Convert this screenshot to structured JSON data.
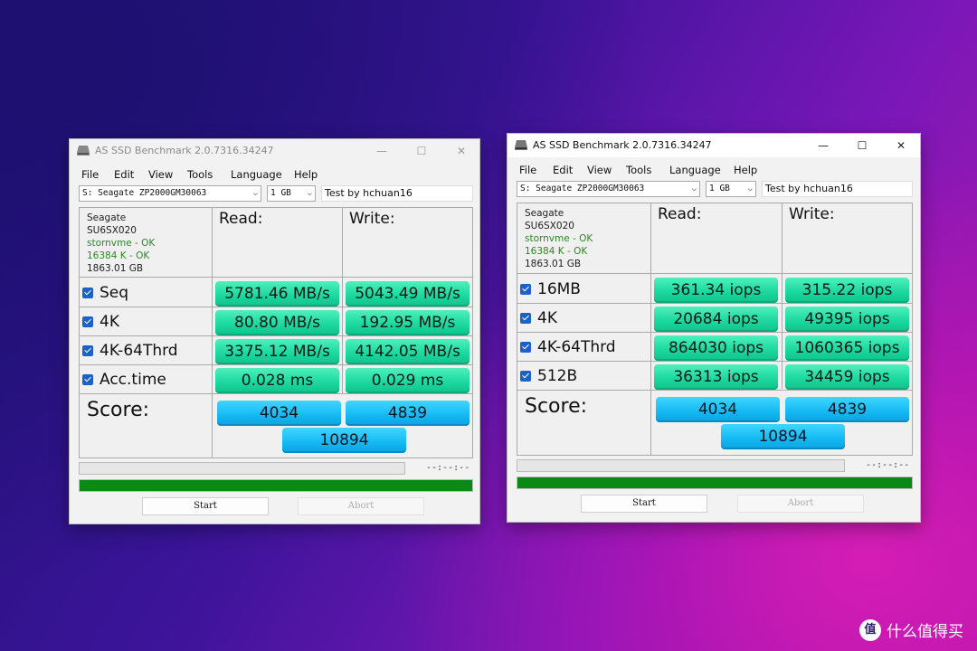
{
  "windows": [
    {
      "title": "AS SSD Benchmark 2.0.7316.34247",
      "controls": {
        "minimize": "—",
        "maximize": "☐",
        "close": "✕"
      },
      "menu": [
        "File",
        "Edit",
        "View",
        "Tools",
        "Language",
        "Help"
      ],
      "drive": "S: Seagate ZP2000GM30063",
      "size": "1 GB",
      "test_name": "Test by hchuan16",
      "info": {
        "vendor": "Seagate",
        "firmware": "SU6SX020",
        "driver": "stornvme - OK",
        "align": "16384 K - OK",
        "capacity": "1863.01 GB"
      },
      "read_label": "Read:",
      "write_label": "Write:",
      "rows": [
        {
          "label": "Seq",
          "read": "5781.46 MB/s",
          "write": "5043.49 MB/s"
        },
        {
          "label": "4K",
          "read": "80.80 MB/s",
          "write": "192.95 MB/s"
        },
        {
          "label": "4K-64Thrd",
          "read": "3375.12 MB/s",
          "write": "4142.05 MB/s"
        },
        {
          "label": "Acc.time",
          "read": "0.028 ms",
          "write": "0.029 ms"
        }
      ],
      "score_label": "Score:",
      "score_read": "4034",
      "score_write": "4839",
      "score_total": "10894",
      "elapsed": "--:--:--",
      "progress": 1.0,
      "start_label": "Start",
      "abort_label": "Abort"
    },
    {
      "title": "AS SSD Benchmark 2.0.7316.34247",
      "controls": {
        "minimize": "—",
        "maximize": "☐",
        "close": "✕"
      },
      "menu": [
        "File",
        "Edit",
        "View",
        "Tools",
        "Language",
        "Help"
      ],
      "drive": "S: Seagate ZP2000GM30063",
      "size": "1 GB",
      "test_name": "Test by hchuan16",
      "info": {
        "vendor": "Seagate",
        "firmware": "SU6SX020",
        "driver": "stornvme - OK",
        "align": "16384 K - OK",
        "capacity": "1863.01 GB"
      },
      "read_label": "Read:",
      "write_label": "Write:",
      "rows": [
        {
          "label": "16MB",
          "read": "361.34 iops",
          "write": "315.22 iops"
        },
        {
          "label": "4K",
          "read": "20684 iops",
          "write": "49395 iops"
        },
        {
          "label": "4K-64Thrd",
          "read": "864030 iops",
          "write": "1060365 iops"
        },
        {
          "label": "512B",
          "read": "36313 iops",
          "write": "34459 iops"
        }
      ],
      "score_label": "Score:",
      "score_read": "4034",
      "score_write": "4839",
      "score_total": "10894",
      "elapsed": "--:--:--",
      "progress": 1.0,
      "start_label": "Start",
      "abort_label": "Abort"
    }
  ],
  "watermark": {
    "icon": "值",
    "text": "什么值得买"
  },
  "colors": {
    "value_green": "#19d79d",
    "score_blue": "#14b8f2",
    "progress_green": "#0a8a14",
    "checkbox_blue": "#1a62c9",
    "ok_green": "#2a8a20"
  }
}
